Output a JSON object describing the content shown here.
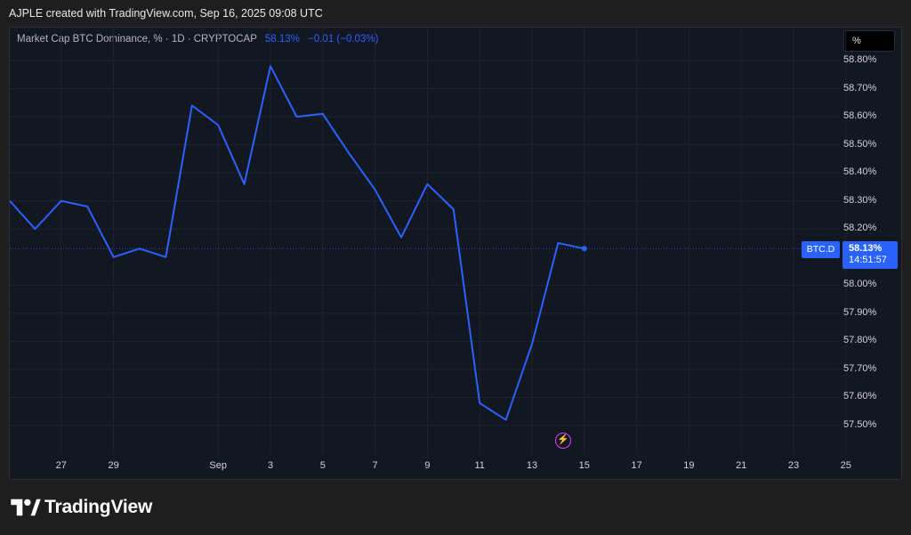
{
  "caption": "AJPLE created with TradingView.com, Sep 16, 2025 09:08 UTC",
  "legend": {
    "name": "Market Cap BTC Dominance, % · 1D · CRYPTOCAP",
    "value": "58.13%",
    "change": "−0.01 (−0.03%)"
  },
  "scale_button": "%",
  "symbol_tag": "BTC.D",
  "price_tag": {
    "value": "58.13%",
    "countdown": "14:51:57"
  },
  "brand": "TradingView",
  "colors": {
    "line": "#2962ff",
    "background": "#131722",
    "accent": "#e040fb"
  },
  "chart_data": {
    "type": "line",
    "title": "Market Cap BTC Dominance, %",
    "ylabel": "%",
    "ylim": [
      57.43,
      58.88
    ],
    "y_ticks": [
      "58.80%",
      "58.70%",
      "58.60%",
      "58.50%",
      "58.40%",
      "58.30%",
      "58.20%",
      "58.00%",
      "57.90%",
      "57.80%",
      "57.70%",
      "57.60%",
      "57.50%"
    ],
    "x_ticks": [
      "27",
      "29",
      "Sep",
      "3",
      "5",
      "7",
      "9",
      "11",
      "13",
      "15",
      "17",
      "19",
      "21",
      "23",
      "25"
    ],
    "series": [
      {
        "x": [
          "2025-08-25",
          "2025-08-26",
          "2025-08-27",
          "2025-08-28",
          "2025-08-29",
          "2025-08-30",
          "2025-08-31",
          "2025-09-01",
          "2025-09-02",
          "2025-09-03",
          "2025-09-04",
          "2025-09-05",
          "2025-09-06",
          "2025-09-07",
          "2025-09-08",
          "2025-09-09",
          "2025-09-10",
          "2025-09-11",
          "2025-09-12",
          "2025-09-13",
          "2025-09-14",
          "2025-09-15",
          "2025-09-16"
        ],
        "values": [
          58.3,
          58.2,
          58.3,
          58.28,
          58.1,
          58.13,
          58.1,
          58.64,
          58.57,
          58.36,
          58.78,
          58.6,
          58.61,
          58.47,
          58.34,
          58.17,
          58.36,
          58.27,
          57.58,
          57.52,
          57.79,
          58.15,
          58.13
        ]
      }
    ],
    "last_value": 58.13
  }
}
